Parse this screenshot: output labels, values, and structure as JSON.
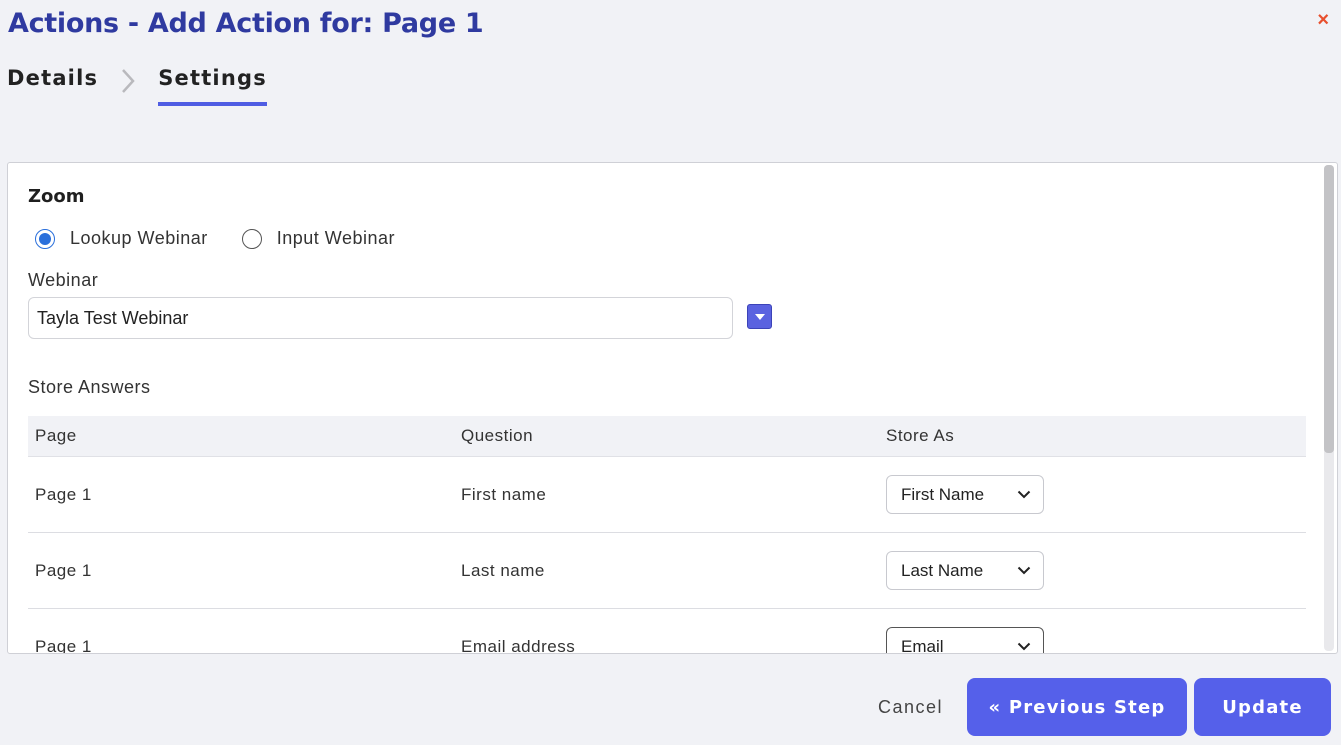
{
  "dialog": {
    "title": "Actions - Add Action for: Page 1",
    "close_label": "×"
  },
  "steps": [
    {
      "label": "Details",
      "active": false
    },
    {
      "label": "Settings",
      "active": true
    }
  ],
  "settings": {
    "section_title": "Zoom",
    "radio_options": [
      {
        "label": "Lookup Webinar",
        "checked": true
      },
      {
        "label": "Input Webinar",
        "checked": false
      }
    ],
    "webinar_label": "Webinar",
    "webinar_value": "Tayla Test Webinar",
    "store_answers_label": "Store Answers",
    "table": {
      "headers": [
        "Page",
        "Question",
        "Store As"
      ],
      "rows": [
        {
          "page": "Page 1",
          "question": "First name",
          "store_as": "First Name"
        },
        {
          "page": "Page 1",
          "question": "Last name",
          "store_as": "Last Name"
        },
        {
          "page": "Page 1",
          "question": "Email address",
          "store_as": "Email"
        }
      ]
    }
  },
  "footer": {
    "cancel_label": "Cancel",
    "previous_label": "« Previous Step",
    "update_label": "Update"
  },
  "colors": {
    "title": "#2f3aa0",
    "accent": "#5560ea",
    "close": "#e8502e",
    "radio_checked": "#2a6fdb"
  }
}
